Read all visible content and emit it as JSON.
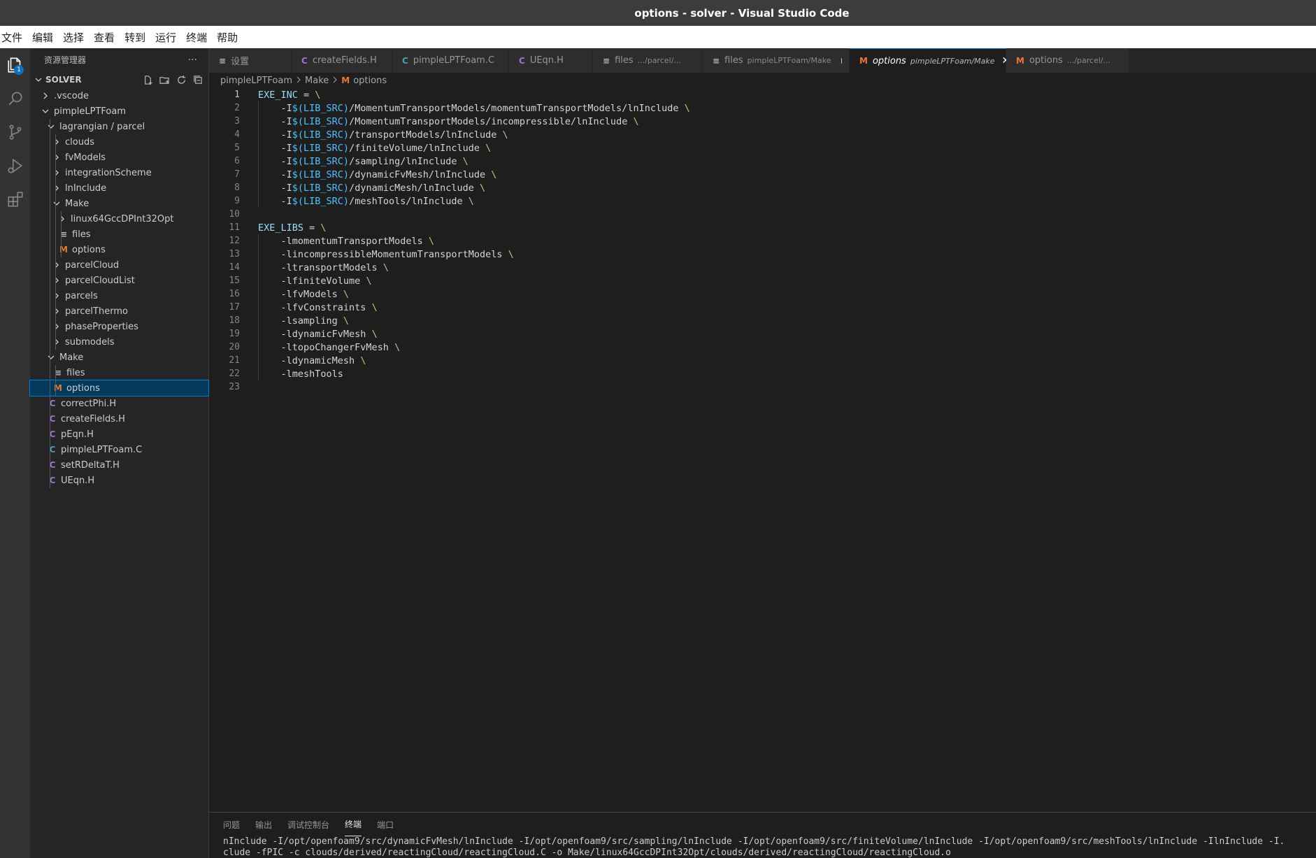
{
  "window": {
    "title": "options - solver - Visual Studio Code"
  },
  "menu": [
    "文件",
    "编辑",
    "选择",
    "查看",
    "转到",
    "运行",
    "终端",
    "帮助"
  ],
  "activity": {
    "explorer_badge": "1"
  },
  "sidebar": {
    "header": "资源管理器",
    "more": "···",
    "section": "SOLVER",
    "tree": [
      {
        "label": ".vscode",
        "depth": 0,
        "type": "folder",
        "open": false
      },
      {
        "label": "pimpleLPTFoam",
        "depth": 0,
        "type": "folder",
        "open": true
      },
      {
        "label": "lagrangian / parcel",
        "depth": 1,
        "type": "folder",
        "open": true
      },
      {
        "label": "clouds",
        "depth": 2,
        "type": "folder",
        "open": false
      },
      {
        "label": "fvModels",
        "depth": 2,
        "type": "folder",
        "open": false
      },
      {
        "label": "integrationScheme",
        "depth": 2,
        "type": "folder",
        "open": false
      },
      {
        "label": "lnInclude",
        "depth": 2,
        "type": "folder",
        "open": false
      },
      {
        "label": "Make",
        "depth": 2,
        "type": "folder",
        "open": true
      },
      {
        "label": "linux64GccDPInt32Opt",
        "depth": 3,
        "type": "folder",
        "open": false
      },
      {
        "label": "files",
        "depth": 3,
        "type": "file",
        "icon": "≡"
      },
      {
        "label": "options",
        "depth": 3,
        "type": "file",
        "icon": "M"
      },
      {
        "label": "parcelCloud",
        "depth": 2,
        "type": "folder",
        "open": false
      },
      {
        "label": "parcelCloudList",
        "depth": 2,
        "type": "folder",
        "open": false
      },
      {
        "label": "parcels",
        "depth": 2,
        "type": "folder",
        "open": false
      },
      {
        "label": "parcelThermo",
        "depth": 2,
        "type": "folder",
        "open": false
      },
      {
        "label": "phaseProperties",
        "depth": 2,
        "type": "folder",
        "open": false
      },
      {
        "label": "submodels",
        "depth": 2,
        "type": "folder",
        "open": false
      },
      {
        "label": "Make",
        "depth": 1,
        "type": "folder",
        "open": true
      },
      {
        "label": "files",
        "depth": 2,
        "type": "file",
        "icon": "≡"
      },
      {
        "label": "options",
        "depth": 2,
        "type": "file",
        "icon": "M",
        "selected": true
      },
      {
        "label": "correctPhi.H",
        "depth": 1,
        "type": "file",
        "icon": "C",
        "lang": "h"
      },
      {
        "label": "createFields.H",
        "depth": 1,
        "type": "file",
        "icon": "C",
        "lang": "h"
      },
      {
        "label": "pEqn.H",
        "depth": 1,
        "type": "file",
        "icon": "C",
        "lang": "h"
      },
      {
        "label": "pimpleLPTFoam.C",
        "depth": 1,
        "type": "file",
        "icon": "C",
        "lang": "c"
      },
      {
        "label": "setRDeltaT.H",
        "depth": 1,
        "type": "file",
        "icon": "C",
        "lang": "h"
      },
      {
        "label": "UEqn.H",
        "depth": 1,
        "type": "file",
        "icon": "C",
        "lang": "h"
      }
    ]
  },
  "tabs": [
    {
      "icon": "≡",
      "kind": "settings",
      "label": "设置",
      "desc": "",
      "width": 118
    },
    {
      "icon": "C",
      "kind": "h",
      "label": "createFields.H",
      "desc": "",
      "width": 144
    },
    {
      "icon": "C",
      "kind": "c",
      "label": "pimpleLPTFoam.C",
      "desc": "",
      "width": 167
    },
    {
      "icon": "C",
      "kind": "h",
      "label": "UEqn.H",
      "desc": "",
      "width": 120
    },
    {
      "icon": "≡",
      "kind": "file",
      "label": "files",
      "desc": ".../parcel/...",
      "width": 157
    },
    {
      "icon": "≡",
      "kind": "file",
      "label": "files",
      "desc": "pimpleLPTFoam/Make",
      "width": 210,
      "dirty": true
    },
    {
      "icon": "M",
      "kind": "m",
      "label": "options",
      "desc": "pimpleLPTFoam/Make",
      "width": 224,
      "active": true
    },
    {
      "icon": "M",
      "kind": "m",
      "label": "options",
      "desc": ".../parcel/...",
      "width": 176
    }
  ],
  "breadcrumb": {
    "parts": [
      "pimpleLPTFoam",
      "Make"
    ],
    "file_icon": "M",
    "file": "options"
  },
  "editor": {
    "current_line": 1,
    "lines": [
      "EXE_INC = \\",
      "    -I$(LIB_SRC)/MomentumTransportModels/momentumTransportModels/lnInclude \\",
      "    -I$(LIB_SRC)/MomentumTransportModels/incompressible/lnInclude \\",
      "    -I$(LIB_SRC)/transportModels/lnInclude \\",
      "    -I$(LIB_SRC)/finiteVolume/lnInclude \\",
      "    -I$(LIB_SRC)/sampling/lnInclude \\",
      "    -I$(LIB_SRC)/dynamicFvMesh/lnInclude \\",
      "    -I$(LIB_SRC)/dynamicMesh/lnInclude \\",
      "    -I$(LIB_SRC)/meshTools/lnInclude \\",
      "",
      "EXE_LIBS = \\",
      "    -lmomentumTransportModels \\",
      "    -lincompressibleMomentumTransportModels \\",
      "    -ltransportModels \\",
      "    -lfiniteVolume \\",
      "    -lfvModels \\",
      "    -lfvConstraints \\",
      "    -lsampling \\",
      "    -ldynamicFvMesh \\",
      "    -ltopoChangerFvMesh \\",
      "    -ldynamicMesh \\",
      "    -lmeshTools",
      ""
    ]
  },
  "panel": {
    "tabs": [
      "问题",
      "输出",
      "调试控制台",
      "终端",
      "端口"
    ],
    "active_tab": 3,
    "terminal_lines": [
      "nInclude -I/opt/openfoam9/src/dynamicFvMesh/lnInclude -I/opt/openfoam9/src/sampling/lnInclude -I/opt/openfoam9/src/finiteVolume/lnInclude -I/opt/openfoam9/src/meshTools/lnInclude -IlnInclude -I.",
      "clude   -fPIC -c clouds/derived/reactingCloud/reactingCloud.C -o Make/linux64GccDPInt32Opt/clouds/derived/reactingCloud/reactingCloud.o"
    ]
  },
  "colors": {
    "accent": "#0e70c0",
    "selection": "#04395e",
    "c_icon": "#519aba",
    "h_icon": "#a074c4",
    "make_icon": "#e37933"
  }
}
